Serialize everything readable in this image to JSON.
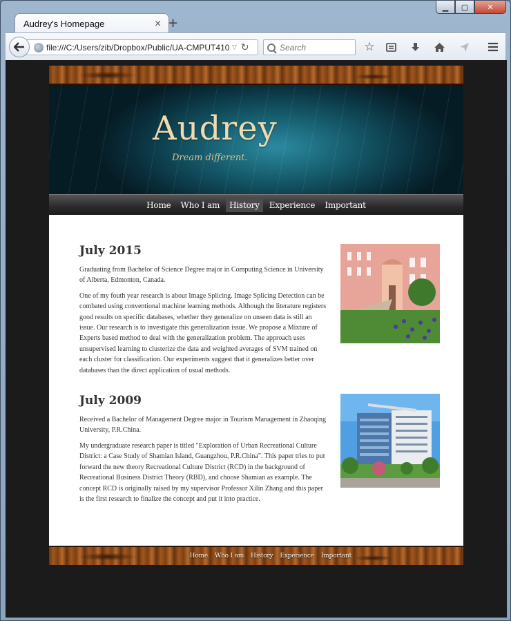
{
  "browser": {
    "tab_title": "Audrey's Homepage",
    "tab_close": "×",
    "new_tab": "+",
    "url": "file:///C:/Users/zib/Dropbox/Public/UA-CMPUT410",
    "search_placeholder": "Search",
    "window_controls": [
      "minimize-icon",
      "maximize-icon",
      "close-icon"
    ],
    "toolbar_icons": [
      "star-icon",
      "reading-list-icon",
      "download-icon",
      "home-icon",
      "share-icon",
      "menu-icon"
    ]
  },
  "site": {
    "brand_title": "Audrey",
    "brand_tagline": "Dream different.",
    "nav": [
      {
        "label": "Home"
      },
      {
        "label": "Who I am"
      },
      {
        "label": "History",
        "active": true
      },
      {
        "label": "Experience"
      },
      {
        "label": "Important"
      }
    ],
    "entries": [
      {
        "heading": "July 2015",
        "paragraphs": [
          "Graduating from Bachelor of Science Degree major in Computing Science in University of Alberta, Edmonton, Canada.",
          "One of my fouth year research is about Image Splicing. Image Splicing Detection can be combated using conventional machine learning methods. Although the literature registers good results on specific databases, whether they generalize on unseen data is still an issue. Our research is to investigate this generalization issue. We propose a Mixture of Experts based method to deal with the generalization problem. The approach uses unsupervised learning to clusterize the data and weighted averages of SVM trained on each cluster for classification. Our experiments suggest that it generalizes better over databases than the direct application of usual methods."
        ],
        "photo": "university-building-photo"
      },
      {
        "heading": "July 2009",
        "paragraphs": [
          "Received a Bachelor of Management Degree major in Tourism Management in Zhaoqing University, P.R.China.",
          "My undergraduate research paper is titled \"Exploration of Urban Recreational Culture District: a Case Study of Shamian Island, Guangzhou, P.R.China\". This paper tries to put forward the new theory Recreational Culture District (RCD) in the background of Recreational Business District Theory (RBD), and choose Shamian as example. The concept RCD is originally raised by my supervisor Professor Xilin Zhang and this paper is the first research to finalize the concept and put it into practice."
        ],
        "photo": "modern-building-photo"
      }
    ],
    "footer_nav": [
      {
        "label": "Home"
      },
      {
        "label": "Who I am"
      },
      {
        "label": "History"
      },
      {
        "label": "Experience"
      },
      {
        "label": "Important"
      }
    ]
  },
  "colors": {
    "page_background": "#1b1b1b",
    "nav_background": "#2a2a2a",
    "nav_active": "#4b4b4b",
    "brand_text": "#f0dab0",
    "banner_teal": "#145868",
    "wood": "#8a4a18"
  }
}
